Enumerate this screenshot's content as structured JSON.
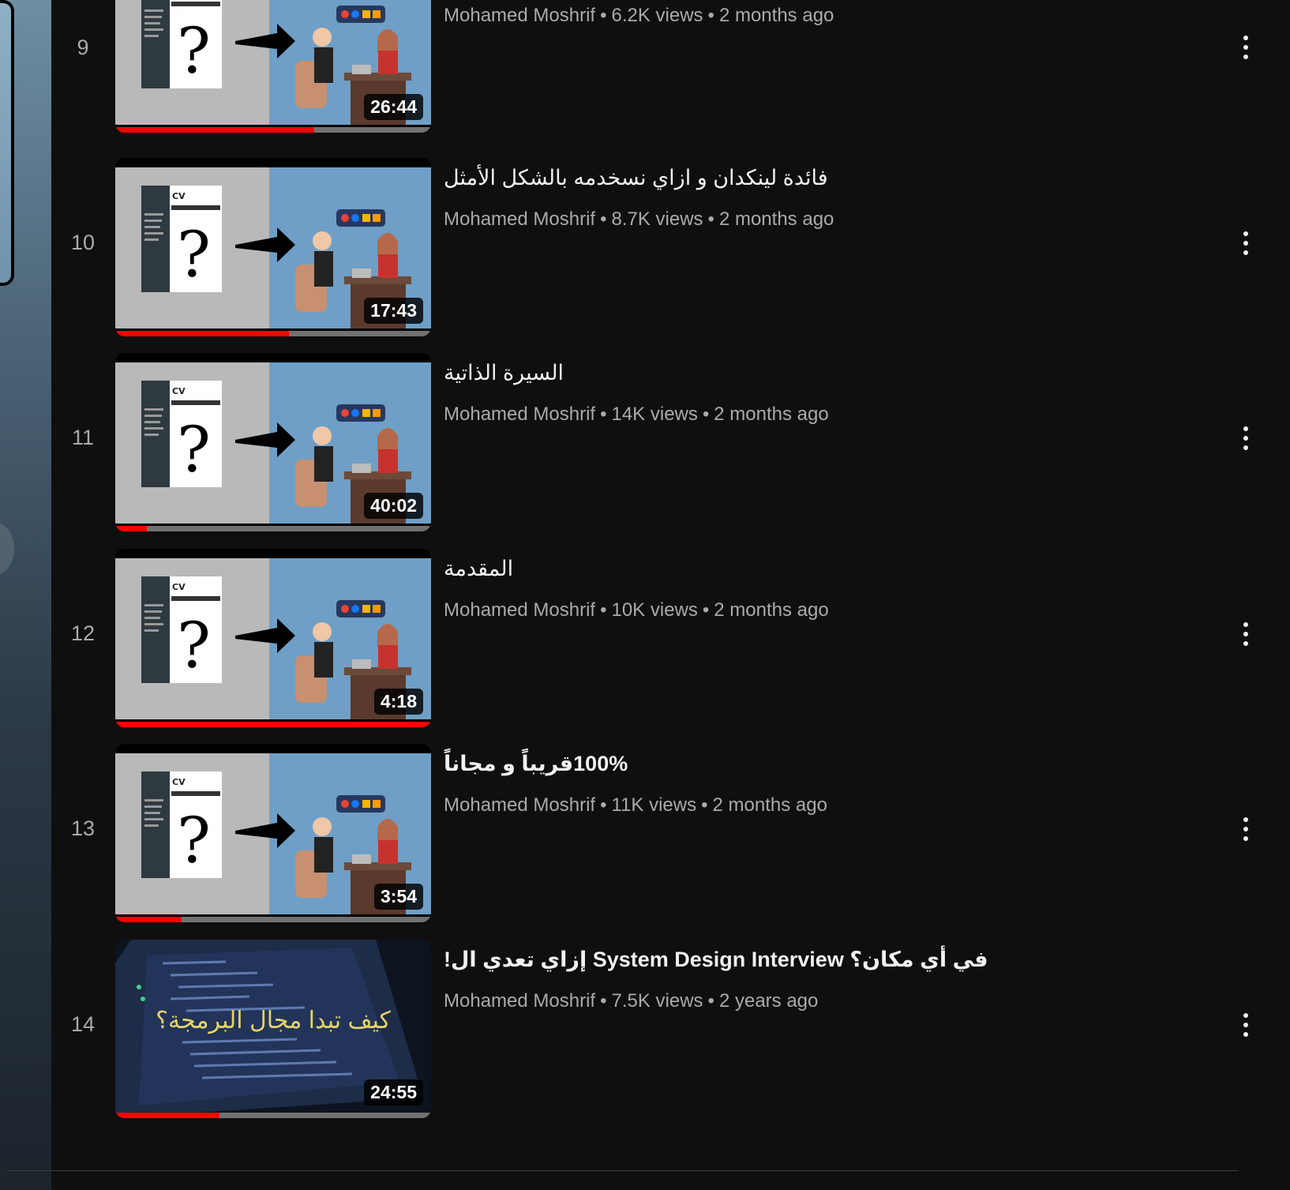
{
  "channel": "Mohamed Moshrif",
  "videos": [
    {
      "index": "9",
      "title": "",
      "views": "6.2K views",
      "age": "2 months ago",
      "duration": "26:44",
      "progress": 0.63,
      "thumb": "cv"
    },
    {
      "index": "10",
      "title": "فائدة لينكدان و ازاي نسخدمه بالشكل الأمثل",
      "views": "8.7K views",
      "age": "2 months ago",
      "duration": "17:43",
      "progress": 0.55,
      "thumb": "cv"
    },
    {
      "index": "11",
      "title": "السيرة الذاتية",
      "views": "14K views",
      "age": "2 months ago",
      "duration": "40:02",
      "progress": 0.1,
      "thumb": "cv"
    },
    {
      "index": "12",
      "title": "المقدمة",
      "views": "10K views",
      "age": "2 months ago",
      "duration": "4:18",
      "progress": 1.0,
      "thumb": "cv"
    },
    {
      "index": "13",
      "title": "100%قريباً و مجاناً",
      "views": "11K views",
      "age": "2 months ago",
      "duration": "3:54",
      "progress": 0.21,
      "thumb": "cv"
    },
    {
      "index": "14",
      "title": "في أي مكان؟ System Design Interview إزاي تعدي ال!",
      "views": "7.5K views",
      "age": "2 years ago",
      "duration": "24:55",
      "progress": 0.33,
      "thumb": "code",
      "thumb_text": "كيف تبدا مجال البرمجة؟"
    }
  ],
  "icons": {
    "menu": "more-vert-icon"
  },
  "colors": {
    "background": "#0f0f0f",
    "progress": "#ff0000",
    "secondary_text": "#aaaaaa"
  }
}
